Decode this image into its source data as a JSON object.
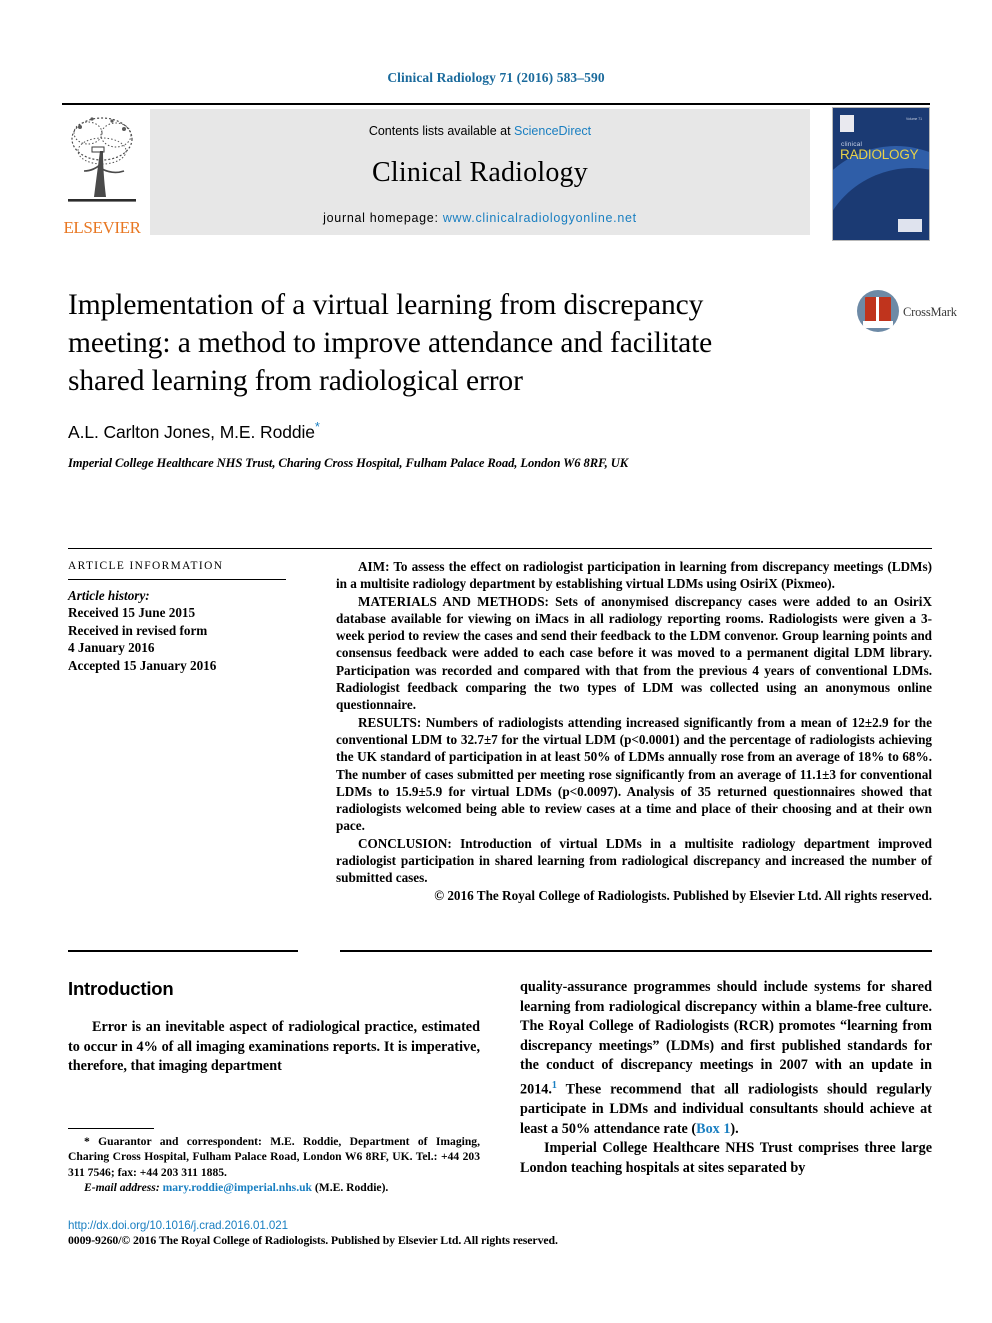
{
  "running_head": "Clinical Radiology 71 (2016) 583–590",
  "masthead": {
    "contents_prefix": "Contents lists available at",
    "sciencedirect": "ScienceDirect",
    "journal_name": "Clinical Radiology",
    "homepage_prefix": "journal homepage:",
    "homepage_url": "www.clinicalradiologyonline.net",
    "publisher_logo_text": "ELSEVIER",
    "cover": {
      "title_small": "clinical",
      "title_large": "RADIOLOGY",
      "top_right_text": "Volume 71"
    }
  },
  "crossmark": {
    "label": "CrossMark"
  },
  "article": {
    "title": "Implementation of a virtual learning from discrepancy meeting: a method to improve attendance and facilitate shared learning from radiological error",
    "authors": "A.L. Carlton Jones, M.E. Roddie",
    "corresponding_marker": "*",
    "affiliation": "Imperial College Healthcare NHS Trust, Charing Cross Hospital, Fulham Palace Road, London W6 8RF, UK"
  },
  "article_information": {
    "heading": "article information",
    "history_label": "Article history:",
    "history_lines": [
      "Received 15 June 2015",
      "Received in revised form",
      "4 January 2016",
      "Accepted 15 January 2016"
    ]
  },
  "abstract": {
    "aim_label": "AIM:",
    "aim_text": " To assess the effect on radiologist participation in learning from discrepancy meetings (LDMs) in a multisite radiology department by establishing virtual LDMs using OsiriX (Pixmeo).",
    "methods_label": "MATERIALS AND METHODS:",
    "methods_text": " Sets of anonymised discrepancy cases were added to an OsiriX database available for viewing on iMacs in all radiology reporting rooms. Radiologists were given a 3-week period to review the cases and send their feedback to the LDM convenor. Group learning points and consensus feedback were added to each case before it was moved to a permanent digital LDM library. Participation was recorded and compared with that from the previous 4 years of conventional LDMs. Radiologist feedback comparing the two types of LDM was collected using an anonymous online questionnaire.",
    "results_label": "RESULTS:",
    "results_text": " Numbers of radiologists attending increased significantly from a mean of 12±2.9 for the conventional LDM to 32.7±7 for the virtual LDM (p<0.0001) and the percentage of radiologists achieving the UK standard of participation in at least 50% of LDMs annually rose from an average of 18% to 68%. The number of cases submitted per meeting rose significantly from an average of 11.1±3 for conventional LDMs to 15.9±5.9 for virtual LDMs (p<0.0097). Analysis of 35 returned questionnaires showed that radiologists welcomed being able to review cases at a time and place of their choosing and at their own pace.",
    "conclusion_label": "CONCLUSION:",
    "conclusion_text": " Introduction of virtual LDMs in a multisite radiology department improved radiologist participation in shared learning from radiological discrepancy and increased the number of submitted cases.",
    "copyright": "© 2016 The Royal College of Radiologists. Published by Elsevier Ltd. All rights reserved."
  },
  "body": {
    "introduction_heading": "Introduction",
    "left_paragraph": "Error is an inevitable aspect of radiological practice, estimated to occur in 4% of all imaging examinations reports. It is imperative, therefore, that imaging department",
    "right_paragraph_1_a": "quality-assurance programmes should include systems for shared learning from radiological discrepancy within a blame-free culture. The Royal College of Radiologists (RCR) promotes “learning from discrepancy meetings” (LDMs) and first published standards for the conduct of discrepancy meetings in 2007 with an update in 2014.",
    "right_paragraph_1_ref": "1",
    "right_paragraph_1_b": " These recommend that all radiologists should regularly participate in LDMs and individual consultants should achieve at least a 50% attendance rate (",
    "right_paragraph_1_box": "Box 1",
    "right_paragraph_1_c": ").",
    "right_paragraph_2": "Imperial College Healthcare NHS Trust comprises three large London teaching hospitals at sites separated by"
  },
  "footnotes": {
    "corresponding_marker": "*",
    "corresponding_text": " Guarantor and correspondent: M.E. Roddie, Department of Imaging, Charing Cross Hospital, Fulham Palace Road, London W6 8RF, UK. Tel.: +44 203 311 7546; fax: +44 203 311 1885.",
    "email_label": "E-mail address:",
    "email_address": "mary.roddie@imperial.nhs.uk",
    "email_owner": "(M.E. Roddie).",
    "doi_url": "http://dx.doi.org/10.1016/j.crad.2016.01.021",
    "issn_line": "0009-9260/© 2016 The Royal College of Radiologists. Published by Elsevier Ltd. All rights reserved."
  },
  "colors": {
    "link_blue": "#1a7fc1",
    "header_blue": "#1a6a9c",
    "elsevier_orange": "#e87722",
    "masthead_grey": "#e7e7e7",
    "cover_navy": "#1b3a73",
    "crossmark_red": "#c0341d"
  }
}
